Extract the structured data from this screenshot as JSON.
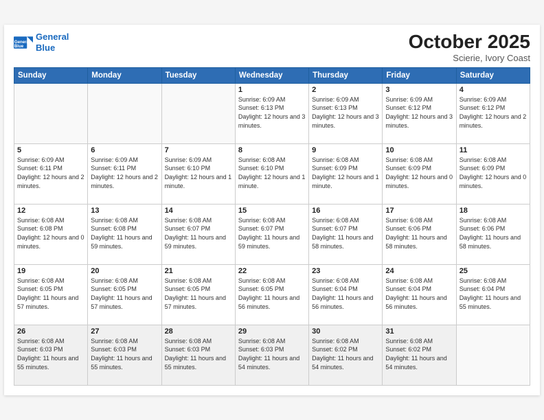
{
  "header": {
    "logo_line1": "General",
    "logo_line2": "Blue",
    "month": "October 2025",
    "location": "Scierie, Ivory Coast"
  },
  "weekdays": [
    "Sunday",
    "Monday",
    "Tuesday",
    "Wednesday",
    "Thursday",
    "Friday",
    "Saturday"
  ],
  "weeks": [
    [
      {
        "day": "",
        "info": ""
      },
      {
        "day": "",
        "info": ""
      },
      {
        "day": "",
        "info": ""
      },
      {
        "day": "1",
        "info": "Sunrise: 6:09 AM\nSunset: 6:13 PM\nDaylight: 12 hours and 3 minutes."
      },
      {
        "day": "2",
        "info": "Sunrise: 6:09 AM\nSunset: 6:13 PM\nDaylight: 12 hours and 3 minutes."
      },
      {
        "day": "3",
        "info": "Sunrise: 6:09 AM\nSunset: 6:12 PM\nDaylight: 12 hours and 3 minutes."
      },
      {
        "day": "4",
        "info": "Sunrise: 6:09 AM\nSunset: 6:12 PM\nDaylight: 12 hours and 2 minutes."
      }
    ],
    [
      {
        "day": "5",
        "info": "Sunrise: 6:09 AM\nSunset: 6:11 PM\nDaylight: 12 hours and 2 minutes."
      },
      {
        "day": "6",
        "info": "Sunrise: 6:09 AM\nSunset: 6:11 PM\nDaylight: 12 hours and 2 minutes."
      },
      {
        "day": "7",
        "info": "Sunrise: 6:09 AM\nSunset: 6:10 PM\nDaylight: 12 hours and 1 minute."
      },
      {
        "day": "8",
        "info": "Sunrise: 6:08 AM\nSunset: 6:10 PM\nDaylight: 12 hours and 1 minute."
      },
      {
        "day": "9",
        "info": "Sunrise: 6:08 AM\nSunset: 6:09 PM\nDaylight: 12 hours and 1 minute."
      },
      {
        "day": "10",
        "info": "Sunrise: 6:08 AM\nSunset: 6:09 PM\nDaylight: 12 hours and 0 minutes."
      },
      {
        "day": "11",
        "info": "Sunrise: 6:08 AM\nSunset: 6:09 PM\nDaylight: 12 hours and 0 minutes."
      }
    ],
    [
      {
        "day": "12",
        "info": "Sunrise: 6:08 AM\nSunset: 6:08 PM\nDaylight: 12 hours and 0 minutes."
      },
      {
        "day": "13",
        "info": "Sunrise: 6:08 AM\nSunset: 6:08 PM\nDaylight: 11 hours and 59 minutes."
      },
      {
        "day": "14",
        "info": "Sunrise: 6:08 AM\nSunset: 6:07 PM\nDaylight: 11 hours and 59 minutes."
      },
      {
        "day": "15",
        "info": "Sunrise: 6:08 AM\nSunset: 6:07 PM\nDaylight: 11 hours and 59 minutes."
      },
      {
        "day": "16",
        "info": "Sunrise: 6:08 AM\nSunset: 6:07 PM\nDaylight: 11 hours and 58 minutes."
      },
      {
        "day": "17",
        "info": "Sunrise: 6:08 AM\nSunset: 6:06 PM\nDaylight: 11 hours and 58 minutes."
      },
      {
        "day": "18",
        "info": "Sunrise: 6:08 AM\nSunset: 6:06 PM\nDaylight: 11 hours and 58 minutes."
      }
    ],
    [
      {
        "day": "19",
        "info": "Sunrise: 6:08 AM\nSunset: 6:05 PM\nDaylight: 11 hours and 57 minutes."
      },
      {
        "day": "20",
        "info": "Sunrise: 6:08 AM\nSunset: 6:05 PM\nDaylight: 11 hours and 57 minutes."
      },
      {
        "day": "21",
        "info": "Sunrise: 6:08 AM\nSunset: 6:05 PM\nDaylight: 11 hours and 57 minutes."
      },
      {
        "day": "22",
        "info": "Sunrise: 6:08 AM\nSunset: 6:05 PM\nDaylight: 11 hours and 56 minutes."
      },
      {
        "day": "23",
        "info": "Sunrise: 6:08 AM\nSunset: 6:04 PM\nDaylight: 11 hours and 56 minutes."
      },
      {
        "day": "24",
        "info": "Sunrise: 6:08 AM\nSunset: 6:04 PM\nDaylight: 11 hours and 56 minutes."
      },
      {
        "day": "25",
        "info": "Sunrise: 6:08 AM\nSunset: 6:04 PM\nDaylight: 11 hours and 55 minutes."
      }
    ],
    [
      {
        "day": "26",
        "info": "Sunrise: 6:08 AM\nSunset: 6:03 PM\nDaylight: 11 hours and 55 minutes."
      },
      {
        "day": "27",
        "info": "Sunrise: 6:08 AM\nSunset: 6:03 PM\nDaylight: 11 hours and 55 minutes."
      },
      {
        "day": "28",
        "info": "Sunrise: 6:08 AM\nSunset: 6:03 PM\nDaylight: 11 hours and 55 minutes."
      },
      {
        "day": "29",
        "info": "Sunrise: 6:08 AM\nSunset: 6:03 PM\nDaylight: 11 hours and 54 minutes."
      },
      {
        "day": "30",
        "info": "Sunrise: 6:08 AM\nSunset: 6:02 PM\nDaylight: 11 hours and 54 minutes."
      },
      {
        "day": "31",
        "info": "Sunrise: 6:08 AM\nSunset: 6:02 PM\nDaylight: 11 hours and 54 minutes."
      },
      {
        "day": "",
        "info": ""
      }
    ]
  ]
}
